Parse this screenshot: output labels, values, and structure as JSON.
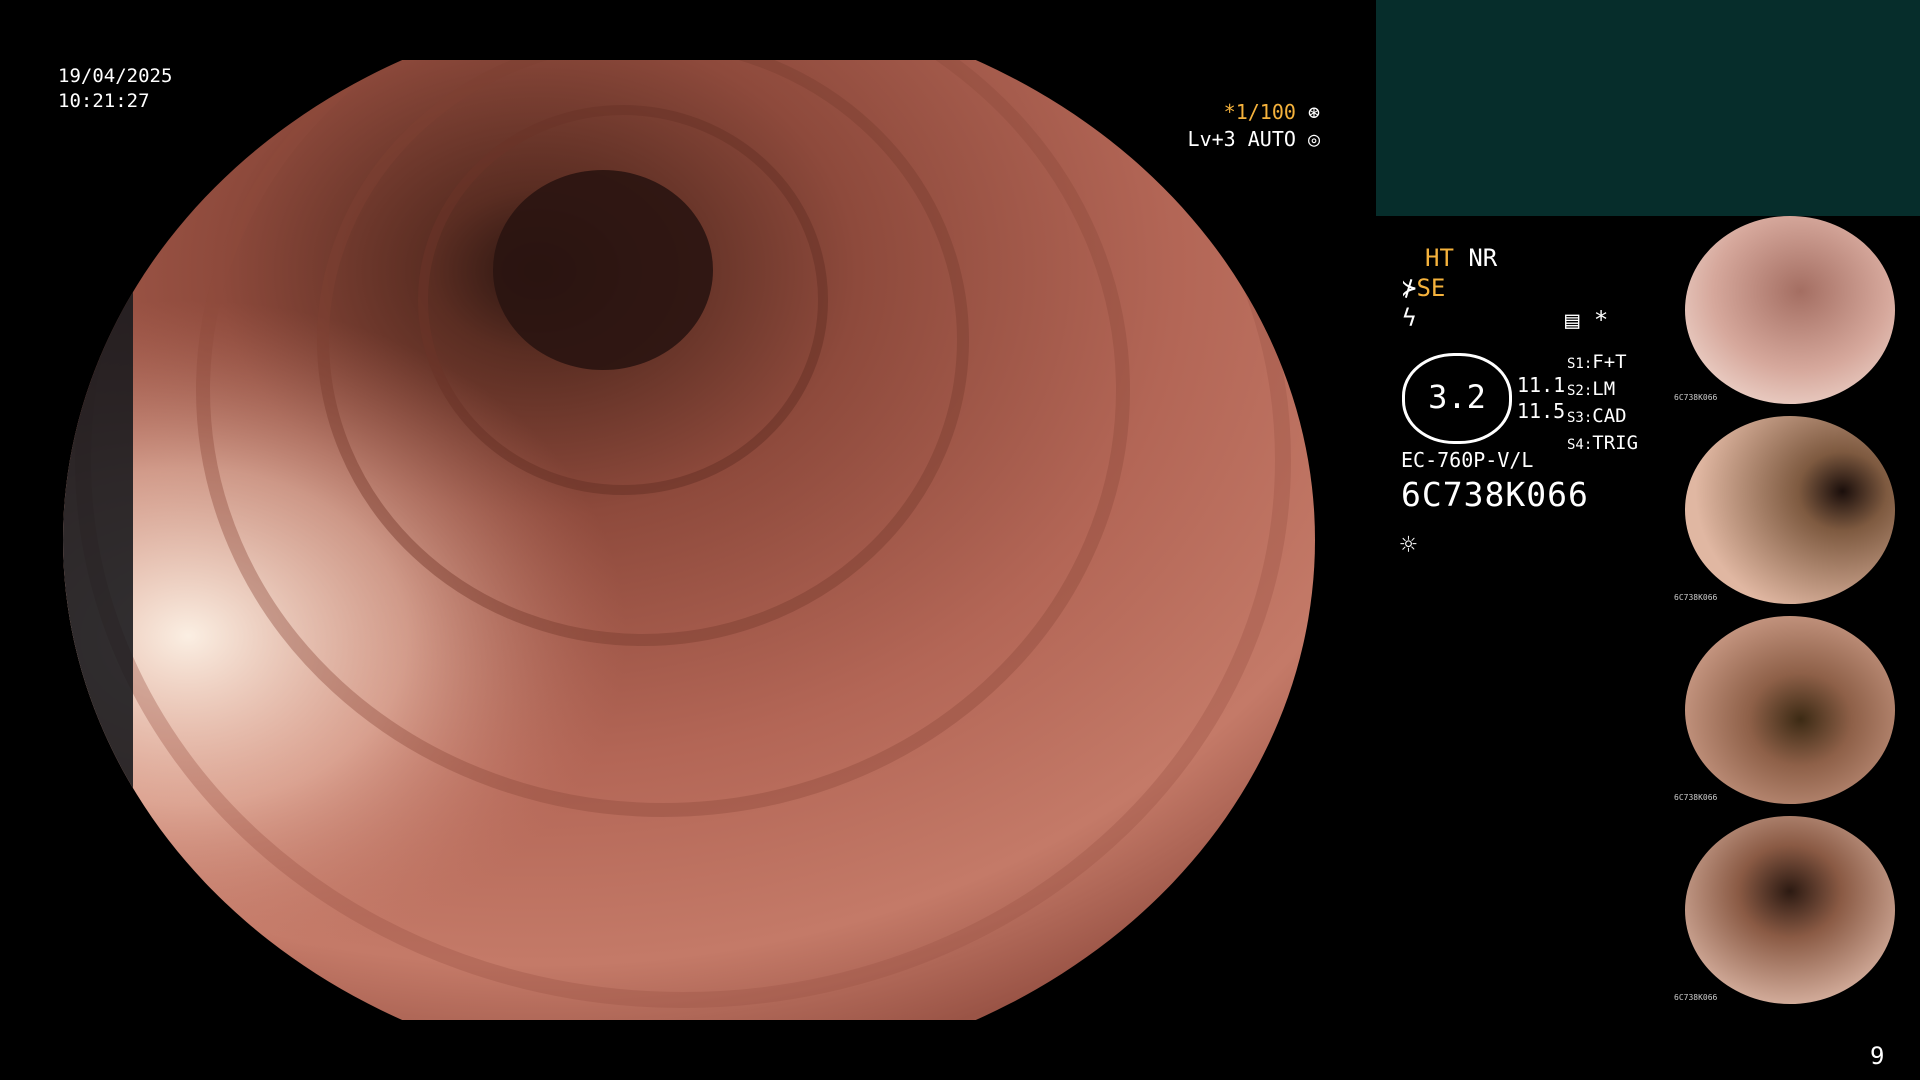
{
  "datetime": {
    "date": "19/04/2025",
    "time": "10:21:27"
  },
  "shutter": {
    "speed": "*1/100",
    "level": "Lv+3 AUTO"
  },
  "status": {
    "ht": "HT",
    "nr": "NR",
    "se": "SE",
    "zoom_value": "3.2",
    "num1": "11.1",
    "num2": "11.5",
    "star": "*",
    "switches": [
      {
        "key": "S1:",
        "value": "F+T"
      },
      {
        "key": "S2:",
        "value": "LM"
      },
      {
        "key": "S3:",
        "value": "CAD"
      },
      {
        "key": "S4:",
        "value": "TRIG"
      }
    ],
    "model": "EC-760P-V/L",
    "serial": "6C738K066"
  },
  "thumbnails": [
    {
      "caption": "6C738K066"
    },
    {
      "caption": "6C738K066"
    },
    {
      "caption": "6C738K066"
    },
    {
      "caption": "6C738K066"
    }
  ],
  "page_number": "9",
  "colors": {
    "teal_panel": "#062d2b",
    "accent_orange": "#f5b23c"
  },
  "icons": [
    "shutter-mode-icon",
    "light-mode-icon",
    "se-icon",
    "flash-icon",
    "memory-icon",
    "brightness-sun-icon"
  ]
}
